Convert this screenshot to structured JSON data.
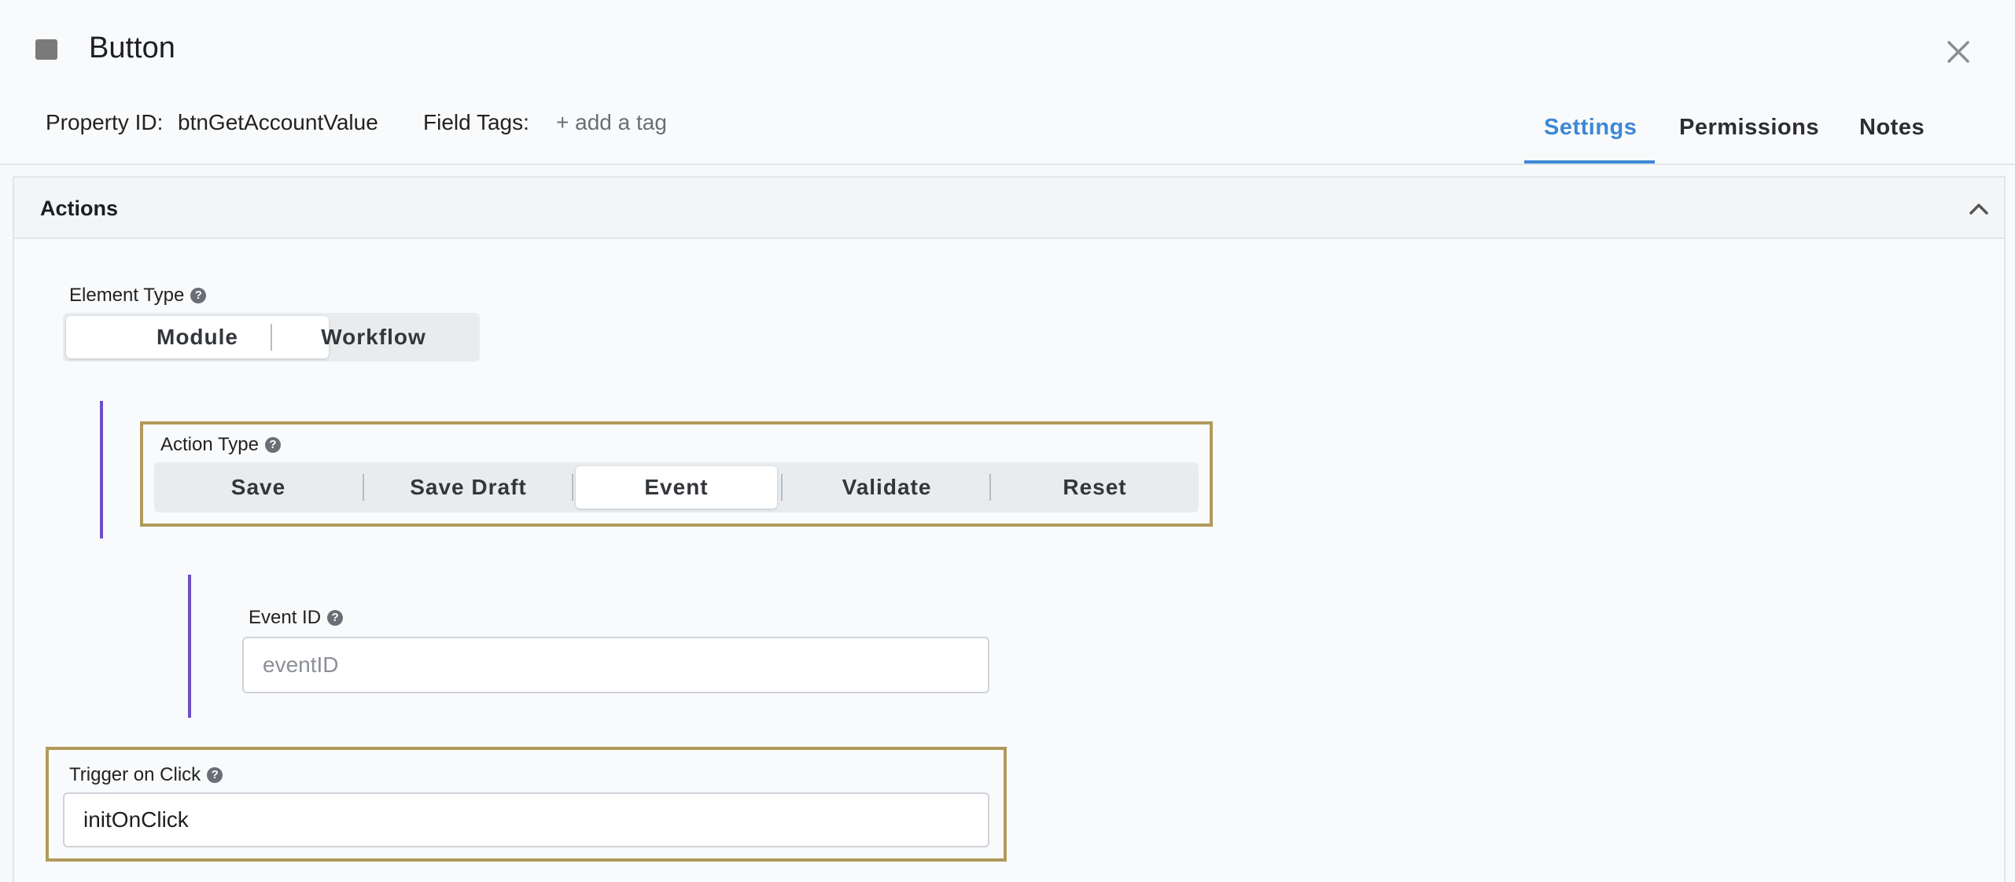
{
  "header": {
    "title": "Button",
    "property_id_label": "Property ID:",
    "property_id_value": "btnGetAccountValue",
    "field_tags_label": "Field Tags:",
    "add_tag": "+ add a tag",
    "tabs": [
      {
        "label": "Settings",
        "active": true
      },
      {
        "label": "Permissions",
        "active": false
      },
      {
        "label": "Notes",
        "active": false
      }
    ]
  },
  "panel": {
    "title": "Actions"
  },
  "element_type": {
    "label": "Element Type",
    "options": [
      "Module",
      "Workflow"
    ],
    "selected": "Module"
  },
  "action_type": {
    "label": "Action Type",
    "options": [
      "Save",
      "Save Draft",
      "Event",
      "Validate",
      "Reset"
    ],
    "selected": "Event"
  },
  "event_id": {
    "label": "Event ID",
    "placeholder": "eventID",
    "value": ""
  },
  "trigger": {
    "label": "Trigger on Click",
    "value": "initOnClick"
  },
  "colors": {
    "accent": "#3d88d6",
    "highlight_border": "#b09a5c",
    "branch_line": "#6e4ec9"
  },
  "icons": {
    "element_icon": "square-icon",
    "close": "close-icon",
    "collapse": "chevron-up-icon",
    "help": "help-circle-icon"
  }
}
